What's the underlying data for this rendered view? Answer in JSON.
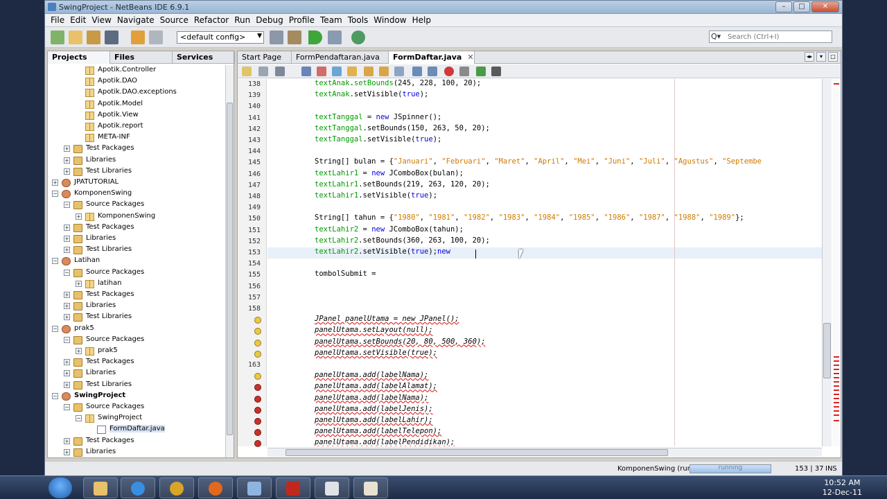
{
  "window": {
    "title": "SwingProject - NetBeans IDE 6.9.1",
    "min": "–",
    "max": "□",
    "close": "✕"
  },
  "menu": [
    "File",
    "Edit",
    "View",
    "Navigate",
    "Source",
    "Refactor",
    "Run",
    "Debug",
    "Profile",
    "Team",
    "Tools",
    "Window",
    "Help"
  ],
  "toolbar": {
    "config": "<default config>",
    "search_placeholder": "Search (Ctrl+I)",
    "search_glyph": "Q▾"
  },
  "left_tabs": [
    "Projects",
    "Files",
    "Services"
  ],
  "tree": [
    {
      "label": "Apotik.Controller",
      "icon": "pkg",
      "indent": 3
    },
    {
      "label": "Apotik.DAO",
      "icon": "pkg",
      "indent": 3
    },
    {
      "label": "Apotik.DAO.exceptions",
      "icon": "pkg",
      "indent": 3
    },
    {
      "label": "Apotik.Model",
      "icon": "pkg",
      "indent": 3
    },
    {
      "label": "Apotik.View",
      "icon": "pkg",
      "indent": 3
    },
    {
      "label": "Apotik.report",
      "icon": "pkg",
      "indent": 3
    },
    {
      "label": "META-INF",
      "icon": "pkg",
      "indent": 3
    },
    {
      "label": "Test Packages",
      "icon": "folder",
      "indent": 2,
      "toggle": "+"
    },
    {
      "label": "Libraries",
      "icon": "folder",
      "indent": 2,
      "toggle": "+"
    },
    {
      "label": "Test Libraries",
      "icon": "folder",
      "indent": 2,
      "toggle": "+"
    },
    {
      "label": "JPATUTORIAL",
      "icon": "project",
      "indent": 1,
      "toggle": "+"
    },
    {
      "label": "KomponenSwing",
      "icon": "project",
      "indent": 1,
      "toggle": "−"
    },
    {
      "label": "Source Packages",
      "icon": "folder",
      "indent": 2,
      "toggle": "−"
    },
    {
      "label": "KomponenSwing",
      "icon": "pkg",
      "indent": 3,
      "toggle": "+"
    },
    {
      "label": "Test Packages",
      "icon": "folder",
      "indent": 2,
      "toggle": "+"
    },
    {
      "label": "Libraries",
      "icon": "folder",
      "indent": 2,
      "toggle": "+"
    },
    {
      "label": "Test Libraries",
      "icon": "folder",
      "indent": 2,
      "toggle": "+"
    },
    {
      "label": "Latihan",
      "icon": "project",
      "indent": 1,
      "toggle": "−"
    },
    {
      "label": "Source Packages",
      "icon": "folder",
      "indent": 2,
      "toggle": "−"
    },
    {
      "label": "latihan",
      "icon": "pkg",
      "indent": 3,
      "toggle": "+"
    },
    {
      "label": "Test Packages",
      "icon": "folder",
      "indent": 2,
      "toggle": "+"
    },
    {
      "label": "Libraries",
      "icon": "folder",
      "indent": 2,
      "toggle": "+"
    },
    {
      "label": "Test Libraries",
      "icon": "folder",
      "indent": 2,
      "toggle": "+"
    },
    {
      "label": "prak5",
      "icon": "project",
      "indent": 1,
      "toggle": "−"
    },
    {
      "label": "Source Packages",
      "icon": "folder",
      "indent": 2,
      "toggle": "−"
    },
    {
      "label": "prak5",
      "icon": "pkg",
      "indent": 3,
      "toggle": "+"
    },
    {
      "label": "Test Packages",
      "icon": "folder",
      "indent": 2,
      "toggle": "+"
    },
    {
      "label": "Libraries",
      "icon": "folder",
      "indent": 2,
      "toggle": "+"
    },
    {
      "label": "Test Libraries",
      "icon": "folder",
      "indent": 2,
      "toggle": "+"
    },
    {
      "label": "SwingProject",
      "icon": "project",
      "indent": 1,
      "toggle": "−",
      "bold": true
    },
    {
      "label": "Source Packages",
      "icon": "folder",
      "indent": 2,
      "toggle": "−"
    },
    {
      "label": "SwingProject",
      "icon": "pkg",
      "indent": 3,
      "toggle": "−"
    },
    {
      "label": "FormDaftar.java",
      "icon": "javafile",
      "indent": 4,
      "selected": true
    },
    {
      "label": "Test Packages",
      "icon": "folder",
      "indent": 2,
      "toggle": "+"
    },
    {
      "label": "Libraries",
      "icon": "folder",
      "indent": 2,
      "toggle": "+"
    }
  ],
  "editor_tabs": [
    {
      "label": "Start Page",
      "active": false
    },
    {
      "label": "FormPendaftaran.java",
      "active": false
    },
    {
      "label": "FormDaftar.java",
      "active": true
    }
  ],
  "tab_close_glyph": "✕",
  "tab_controls": [
    "◂▸",
    "▾",
    "□"
  ],
  "gutter": [
    {
      "n": "138"
    },
    {
      "n": "139"
    },
    {
      "n": "140"
    },
    {
      "n": "141"
    },
    {
      "n": "142"
    },
    {
      "n": "143"
    },
    {
      "n": "144"
    },
    {
      "n": "145"
    },
    {
      "n": "146"
    },
    {
      "n": "147"
    },
    {
      "n": "148"
    },
    {
      "n": "149"
    },
    {
      "n": "150"
    },
    {
      "n": "151"
    },
    {
      "n": "152"
    },
    {
      "n": "153"
    },
    {
      "n": "154"
    },
    {
      "n": "155"
    },
    {
      "n": "156"
    },
    {
      "n": "157"
    },
    {
      "n": "158"
    },
    {
      "n": "",
      "m": "warn"
    },
    {
      "n": "",
      "m": "warn"
    },
    {
      "n": "",
      "m": "warn"
    },
    {
      "n": "",
      "m": "warn"
    },
    {
      "n": "163"
    },
    {
      "n": "",
      "m": "warn"
    },
    {
      "n": "",
      "m": "err"
    },
    {
      "n": "",
      "m": "err"
    },
    {
      "n": "",
      "m": "err"
    },
    {
      "n": "",
      "m": "err"
    },
    {
      "n": "",
      "m": "err"
    },
    {
      "n": "",
      "m": "err"
    }
  ],
  "code": [
    [
      [
        "fld",
        "textAnak"
      ],
      [
        "",
        "."
      ],
      [
        "fld",
        "setBounds"
      ],
      [
        "",
        "(245, 228, 100, 20);"
      ]
    ],
    [
      [
        "fld",
        "textAnak"
      ],
      [
        "",
        ".setVisible("
      ],
      [
        "kw",
        "true"
      ],
      [
        "",
        ");"
      ]
    ],
    [],
    [
      [
        "fld",
        "textTanggal"
      ],
      [
        "",
        "",
        " = "
      ],
      [
        "kw",
        "new"
      ],
      [
        "",
        " JSpinner();"
      ]
    ],
    [
      [
        "fld",
        "textTanggal"
      ],
      [
        "",
        ".setBounds(150, 263, 50, 20);"
      ]
    ],
    [
      [
        "fld",
        "textTanggal"
      ],
      [
        "",
        ".setVisible("
      ],
      [
        "kw",
        "true"
      ],
      [
        "",
        ");"
      ]
    ],
    [],
    [
      [
        "",
        "String[] bulan = {"
      ],
      [
        "str",
        "\"Januari\""
      ],
      [
        "",
        ", "
      ],
      [
        "str",
        "\"Februari\""
      ],
      [
        "",
        ", "
      ],
      [
        "str",
        "\"Maret\""
      ],
      [
        "",
        ", "
      ],
      [
        "str",
        "\"April\""
      ],
      [
        "",
        ", "
      ],
      [
        "str",
        "\"Mei\""
      ],
      [
        "",
        ", "
      ],
      [
        "str",
        "\"Juni\""
      ],
      [
        "",
        ", "
      ],
      [
        "str",
        "\"Juli\""
      ],
      [
        "",
        ", "
      ],
      [
        "str",
        "\"Agustus\""
      ],
      [
        "",
        ", "
      ],
      [
        "str",
        "\"Septembe"
      ]
    ],
    [
      [
        "fld",
        "textLahir1"
      ],
      [
        "",
        " = "
      ],
      [
        "kw",
        "new"
      ],
      [
        "",
        " JComboBox(bulan);"
      ]
    ],
    [
      [
        "fld",
        "textLahir1"
      ],
      [
        "",
        ".setBounds(219, 263, 120, 20);"
      ]
    ],
    [
      [
        "fld",
        "textLahir1"
      ],
      [
        "",
        ".setVisible("
      ],
      [
        "kw",
        "true"
      ],
      [
        "",
        ");"
      ]
    ],
    [],
    [
      [
        "",
        "String[] tahun = {"
      ],
      [
        "str",
        "\"1980\""
      ],
      [
        "",
        ", "
      ],
      [
        "str",
        "\"1981\""
      ],
      [
        "",
        ", "
      ],
      [
        "str",
        "\"1982\""
      ],
      [
        "",
        ", "
      ],
      [
        "str",
        "\"1983\""
      ],
      [
        "",
        ", "
      ],
      [
        "str",
        "\"1984\""
      ],
      [
        "",
        ", "
      ],
      [
        "str",
        "\"1985\""
      ],
      [
        "",
        ", "
      ],
      [
        "str",
        "\"1986\""
      ],
      [
        "",
        ", "
      ],
      [
        "str",
        "\"1987\""
      ],
      [
        "",
        ", "
      ],
      [
        "str",
        "\"1988\""
      ],
      [
        "",
        ", "
      ],
      [
        "str",
        "\"1989\""
      ],
      [
        "",
        "};"
      ]
    ],
    [
      [
        "fld",
        "textLahir2"
      ],
      [
        "",
        " = "
      ],
      [
        "kw",
        "new"
      ],
      [
        "",
        " JComboBox(tahun);"
      ]
    ],
    [
      [
        "fld",
        "textLahir2"
      ],
      [
        "",
        ".setBounds(360, 263, 100, 20);"
      ]
    ],
    [
      [
        "fld",
        "textLahir2"
      ],
      [
        "",
        ".setVisible("
      ],
      [
        "kw",
        "true"
      ],
      [
        "",
        ");"
      ],
      [
        "kw",
        "new"
      ],
      [
        "",
        " "
      ]
    ],
    [],
    [
      [
        "",
        "tombolSubmit ="
      ]
    ],
    [],
    [],
    [],
    [
      [
        "ital",
        "JPanel panelUtama = new JPanel();"
      ]
    ],
    [
      [
        "ital",
        "panelUtama.setLayout(null);"
      ]
    ],
    [
      [
        "ital",
        "panelUtama.setBounds(20, 80, 500, 360);"
      ]
    ],
    [
      [
        "ital",
        "panelUtama.setVisible(true);"
      ]
    ],
    [],
    [
      [
        "ital",
        "panelUtama.add(labelNama);"
      ]
    ],
    [
      [
        "ital",
        "panelUtama.add(labelAlamat);"
      ]
    ],
    [
      [
        "ital",
        "panelUtama.add(labelNama);"
      ]
    ],
    [
      [
        "ital",
        "panelUtama.add(labelJenis);"
      ]
    ],
    [
      [
        "ital",
        "panelUtama.add(labelLahir);"
      ]
    ],
    [
      [
        "ital",
        "panelUtama.add(labelTelepon);"
      ]
    ],
    [
      [
        "ital",
        "panelUtama.add(labelPendidikan);"
      ]
    ]
  ],
  "current_line_index": 15,
  "status": {
    "project": "KomponenSwing (run)",
    "progress_label": "running",
    "progress_fraction": 1.0,
    "position": "153 | 37",
    "mode": "INS"
  },
  "clock": {
    "time": "10:52 AM",
    "date": "12-Dec-11"
  },
  "colors": {
    "accent": "#1b5ca8",
    "error": "#c8322a",
    "warning": "#e9c84a"
  }
}
